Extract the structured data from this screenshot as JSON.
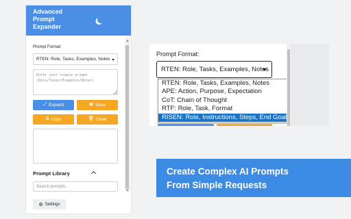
{
  "popup": {
    "title_line1": "Advanced",
    "title_line2": "Prompt",
    "title_line3": "Expander",
    "theme_icon": "moon-icon",
    "prompt_format_label": "Prompt Format:",
    "prompt_format_value": "RTEN: Role, Tasks, Examples, Notes",
    "input_placeholder": "Enter your simple prompt (Role/Tasks/Examples/Notes)",
    "buttons": {
      "expand": "Expand",
      "save": "Save",
      "copy": "Copy",
      "clear": "Clear"
    },
    "library_title": "Prompt Library",
    "search_placeholder": "Search prompts...",
    "settings_label": "Settings"
  },
  "zoom": {
    "label": "Prompt Format:",
    "selected": "RTEN: Role, Tasks, Examples, Notes",
    "options": [
      "RTEN: Role, Tasks, Examples, Notes",
      "APE: Action, Purpose, Expectation",
      "CoT: Chain of Thought",
      "RTF: Role, Task, Format",
      "RISEN: Role, Instructions, Steps, End Goal, Narrowing"
    ],
    "highlighted_option": "RISEN: Role, Instructions, Steps, End Goal, Narrowing"
  },
  "banner": {
    "line1": "Create Complex AI Prompts",
    "line2": "From Simple Requests"
  },
  "colors": {
    "primary_blue": "#4a8ee6",
    "accent_orange": "#f5a623",
    "banner_blue": "#3b8ae4",
    "highlight_blue": "#1a73c7"
  }
}
